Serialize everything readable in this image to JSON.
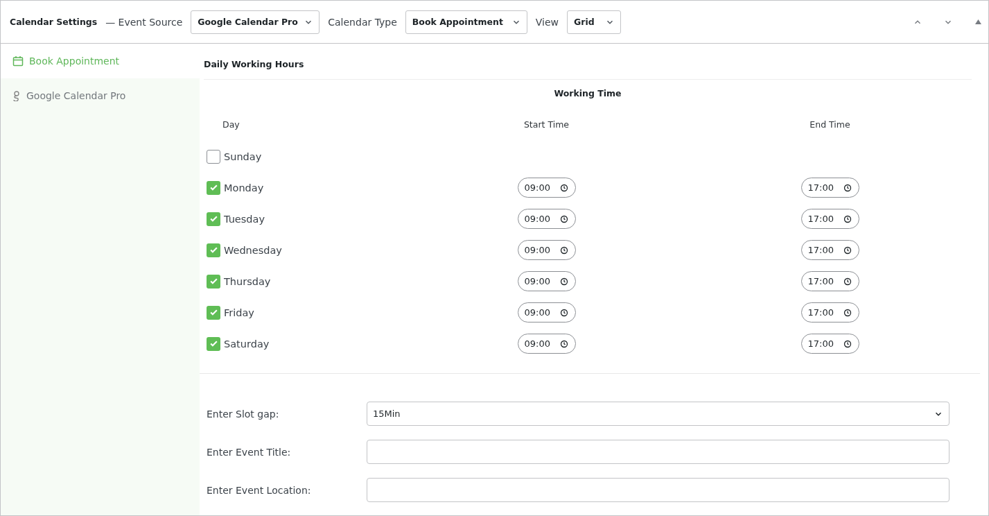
{
  "header": {
    "title": "Calendar Settings",
    "event_source_label": "— Event Source",
    "event_source": "Google Calendar Pro",
    "calendar_type_label": "Calendar Type",
    "calendar_type": "Book Appointment",
    "view_label": "View",
    "view": "Grid"
  },
  "sidebar": {
    "items": [
      {
        "label": "Book Appointment",
        "kind": "calendar",
        "selected": true
      },
      {
        "label": "Google Calendar Pro",
        "kind": "google",
        "selected": false
      }
    ]
  },
  "section_title": "Daily Working Hours",
  "table": {
    "title": "Working Time",
    "columns": [
      "Day",
      "Start Time",
      "End Time"
    ],
    "rows": [
      {
        "day": "Sunday",
        "checked": false
      },
      {
        "day": "Monday",
        "checked": true,
        "start": "09:00",
        "end": "17:00"
      },
      {
        "day": "Tuesday",
        "checked": true,
        "start": "09:00",
        "end": "17:00"
      },
      {
        "day": "Wednesday",
        "checked": true,
        "start": "09:00",
        "end": "17:00"
      },
      {
        "day": "Thursday",
        "checked": true,
        "start": "09:00",
        "end": "17:00"
      },
      {
        "day": "Friday",
        "checked": true,
        "start": "09:00",
        "end": "17:00"
      },
      {
        "day": "Saturday",
        "checked": true,
        "start": "09:00",
        "end": "17:00"
      }
    ]
  },
  "form": [
    {
      "label": "Enter Slot gap:",
      "kind": "select",
      "value": "15Min"
    },
    {
      "label": "Enter Event Title:",
      "kind": "text"
    },
    {
      "label": "Enter Event Location:",
      "kind": "text"
    }
  ]
}
